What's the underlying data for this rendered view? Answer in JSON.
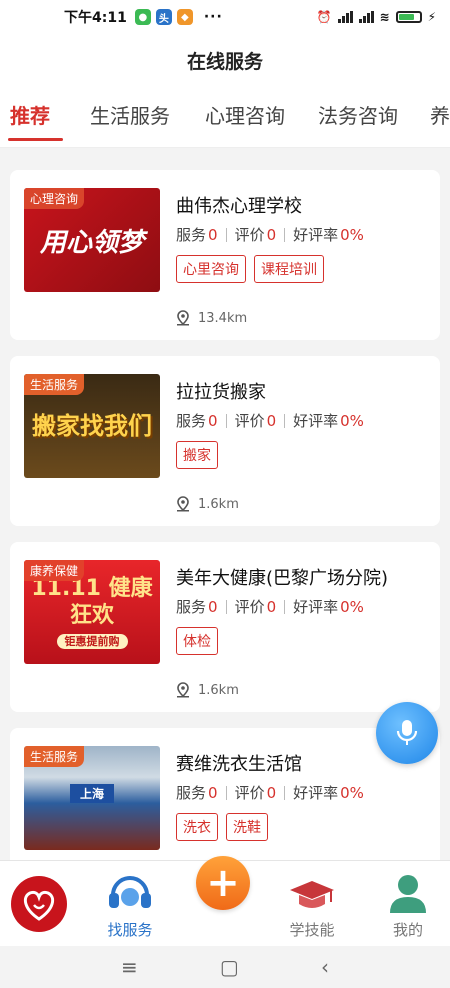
{
  "status_bar": {
    "time": "下午4:11",
    "battery_label": "67"
  },
  "header": {
    "title": "在线服务"
  },
  "tabs": [
    {
      "label": "推荐",
      "active": true
    },
    {
      "label": "生活服务",
      "active": false
    },
    {
      "label": "心理咨询",
      "active": false
    },
    {
      "label": "法务咨询",
      "active": false
    },
    {
      "label": "养",
      "active": false
    }
  ],
  "stats_labels": {
    "service": "服务",
    "rating": "评价",
    "good_rate": "好评率"
  },
  "services": [
    {
      "badge": "心理咨询",
      "thumb_text": "用心领梦",
      "name": "曲伟杰心理学校",
      "service_count": "0",
      "rating_count": "0",
      "good_rate": "0%",
      "tags": [
        "心里咨询",
        "课程培训"
      ],
      "distance": "13.4km"
    },
    {
      "badge": "生活服务",
      "thumb_text": "搬家找我们",
      "name": "拉拉货搬家",
      "service_count": "0",
      "rating_count": "0",
      "good_rate": "0%",
      "tags": [
        "搬家"
      ],
      "distance": "1.6km"
    },
    {
      "badge": "康养保健",
      "thumb_text": "11.11 健康狂欢",
      "thumb_sub": "钜惠提前购",
      "name": "美年大健康(巴黎广场分院)",
      "service_count": "0",
      "rating_count": "0",
      "good_rate": "0%",
      "tags": [
        "体检"
      ],
      "distance": "1.6km"
    },
    {
      "badge": "生活服务",
      "thumb_text": "上海",
      "name": "赛维洗衣生活馆",
      "service_count": "0",
      "rating_count": "0",
      "good_rate": "0%",
      "tags": [
        "洗衣",
        "洗鞋"
      ],
      "distance": ""
    }
  ],
  "bottom_nav": {
    "items": [
      {
        "label": "",
        "icon": "brand-logo-icon"
      },
      {
        "label": "找服务",
        "icon": "headset-icon",
        "active": true
      },
      {
        "label": "",
        "icon": "plus-icon"
      },
      {
        "label": "学技能",
        "icon": "graduation-cap-icon"
      },
      {
        "label": "我的",
        "icon": "person-icon"
      }
    ]
  },
  "colors": {
    "accent": "#d6322d",
    "nav_active": "#2a73c8",
    "fab": "#f06a18",
    "mic": "#1f86e8"
  }
}
